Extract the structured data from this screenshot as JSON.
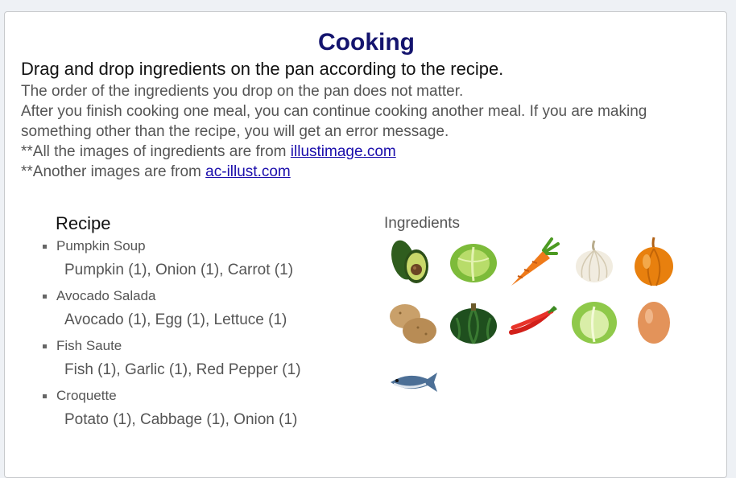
{
  "title": "Cooking",
  "subtitle": "Drag and drop ingredients on the pan according to the recipe.",
  "description": {
    "line1": "The order of the ingredients you drop on the pan does not matter.",
    "line2": "After you finish cooking one meal, you can continue cooking another meal. If you are making something other than the recipe, you will get an error message.",
    "credit1_prefix": "**All the images of ingredients are from ",
    "credit1_link": "illustimage.com",
    "credit2_prefix": "**Another images are from ",
    "credit2_link": "ac-illust.com"
  },
  "recipe": {
    "heading": "Recipe",
    "items": [
      {
        "name": "Pumpkin Soup",
        "ingredients": "Pumpkin (1), Onion (1), Carrot (1)"
      },
      {
        "name": "Avocado Salada",
        "ingredients": "Avocado (1), Egg (1), Lettuce (1)"
      },
      {
        "name": "Fish Saute",
        "ingredients": "Fish (1), Garlic (1), Red Pepper (1)"
      },
      {
        "name": "Croquette",
        "ingredients": "Potato (1), Cabbage (1), Onion (1)"
      }
    ]
  },
  "ingredients": {
    "heading": "Ingredients",
    "icons": [
      "avocado-icon",
      "cabbage-icon",
      "carrot-icon",
      "garlic-icon",
      "onion-icon",
      "potato-icon",
      "pumpkin-icon",
      "red-pepper-icon",
      "lettuce-icon",
      "egg-icon",
      "fish-icon"
    ]
  }
}
